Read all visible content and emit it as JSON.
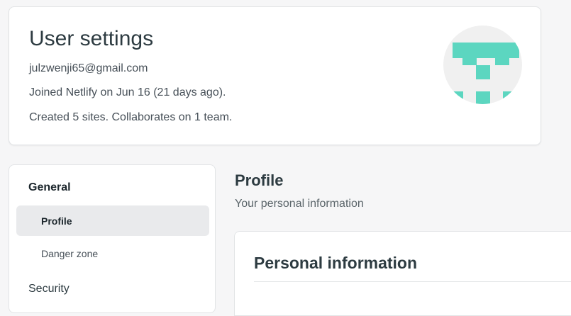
{
  "header": {
    "title": "User settings",
    "email": "julzwenji65@gmail.com",
    "joined": "Joined Netlify on Jun 16 (21 days ago).",
    "created": "Created 5 sites. Collaborates on 1 team."
  },
  "avatar": {
    "icon": "identicon",
    "accent_color": "#5cd6c0",
    "background_color": "#f0f0f0"
  },
  "sidebar": {
    "groups": [
      {
        "label": "General",
        "items": [
          {
            "label": "Profile",
            "active": true
          },
          {
            "label": "Danger zone",
            "active": false
          }
        ]
      },
      {
        "label": "Security",
        "items": []
      }
    ]
  },
  "main": {
    "section_title": "Profile",
    "section_subtitle": "Your personal information",
    "card_title": "Personal information"
  }
}
